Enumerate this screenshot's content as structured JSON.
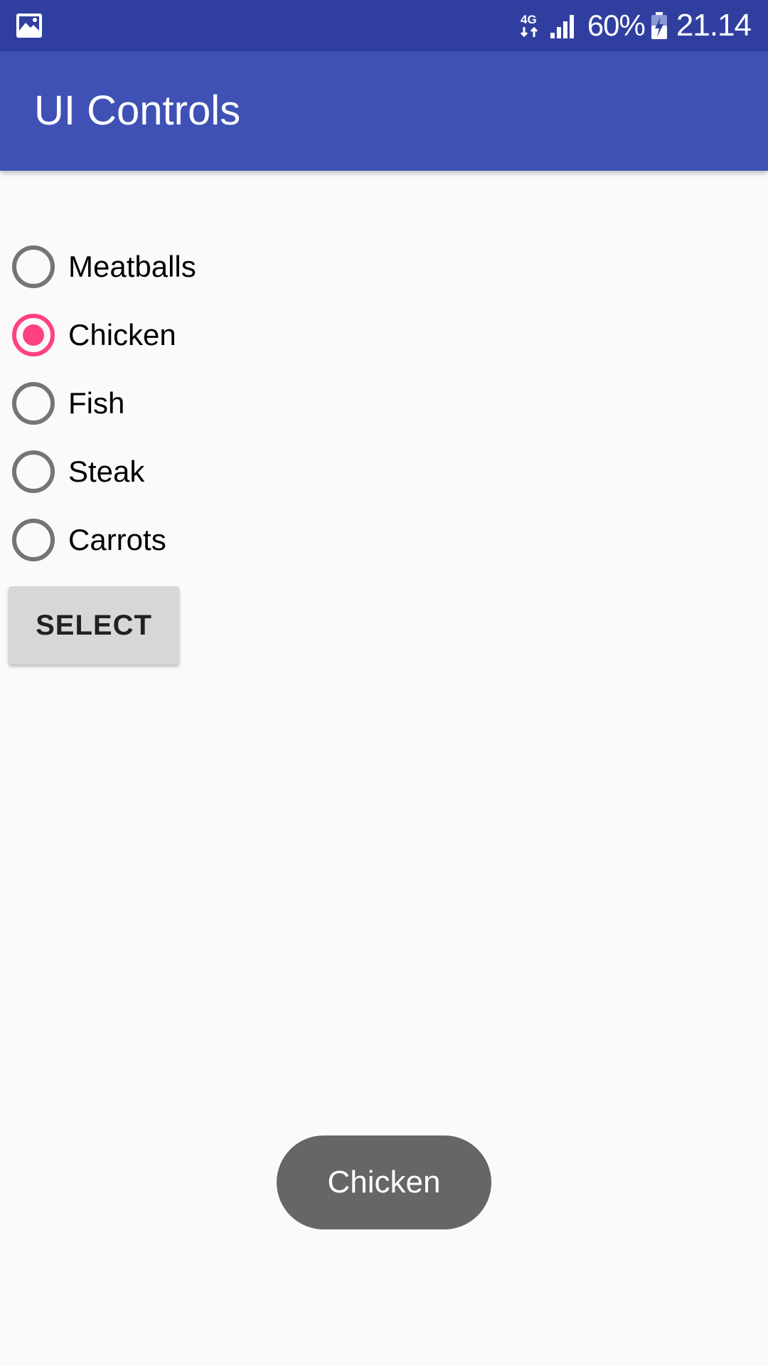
{
  "status_bar": {
    "left_icon": "image-icon",
    "network_icon": "network-4g-icon",
    "network_label": "4G",
    "signal_icon": "signal-strength-icon",
    "battery_percent": "60%",
    "battery_icon": "battery-charging-icon",
    "time": "21.14",
    "background": "#303f9f"
  },
  "app_bar": {
    "title": "UI Controls",
    "background": "#3f51b5"
  },
  "radio_group": {
    "accent_color": "#ff4081",
    "unchecked_color": "#757575",
    "selected": "Chicken",
    "options": [
      {
        "label": "Meatballs",
        "checked": false
      },
      {
        "label": "Chicken",
        "checked": true
      },
      {
        "label": "Fish",
        "checked": false
      },
      {
        "label": "Steak",
        "checked": false
      },
      {
        "label": "Carrots",
        "checked": false
      }
    ]
  },
  "select_button": {
    "label": "SELECT"
  },
  "toast": {
    "message": "Chicken",
    "background": "#666666"
  }
}
